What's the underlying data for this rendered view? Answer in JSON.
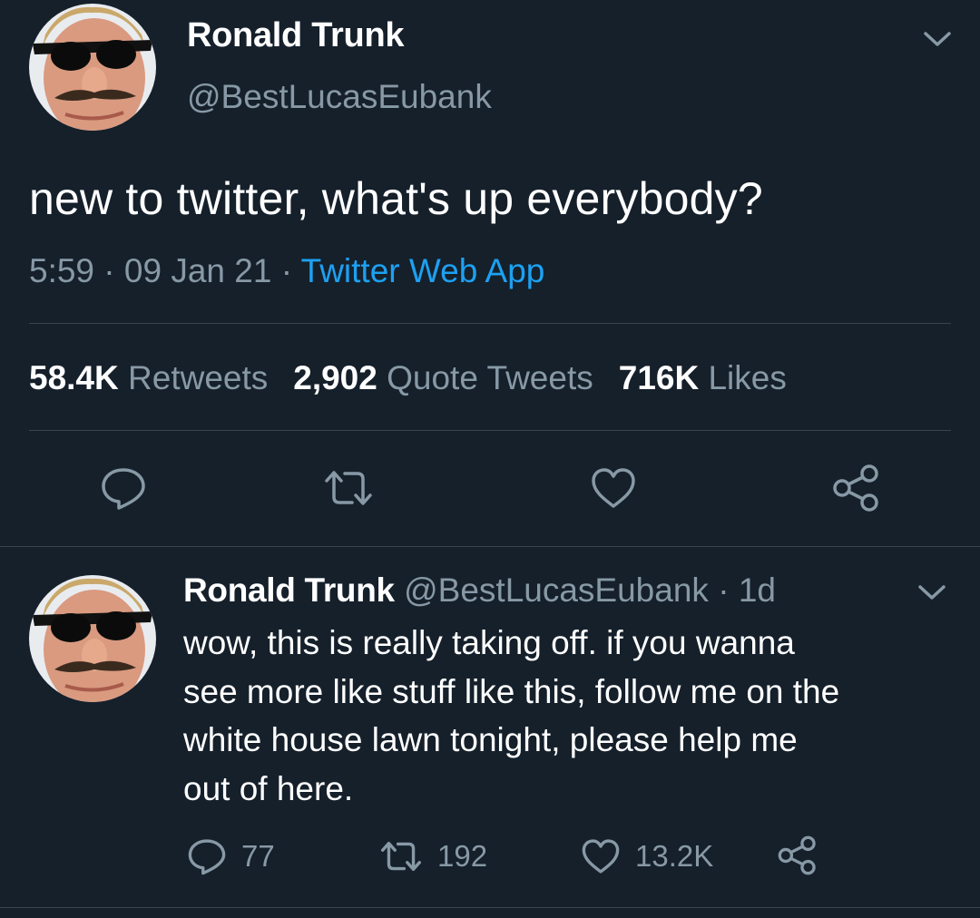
{
  "main_tweet": {
    "display_name": "Ronald Trunk",
    "handle": "@BestLucasEubank",
    "text": "new to twitter, what's up everybody?",
    "time": "5:59",
    "separator": " · ",
    "date": "09 Jan 21",
    "source": "Twitter Web App",
    "stats": {
      "retweets_count": "58.4K",
      "retweets_label": "Retweets",
      "quotes_count": "2,902",
      "quotes_label": "Quote Tweets",
      "likes_count": "716K",
      "likes_label": "Likes"
    },
    "icons": {
      "menu": "chevron-down-icon",
      "reply": "reply-bubble-icon",
      "retweet": "retweet-icon",
      "like": "heart-icon",
      "share": "share-icon"
    }
  },
  "reply_tweet": {
    "display_name": "Ronald Trunk",
    "handle": "@BestLucasEubank",
    "age": "1d",
    "separator": " · ",
    "lines": [
      "wow, this is really taking off. if you wanna",
      "see more like stuff like this, follow me on the",
      "white house lawn tonight, please help me",
      "out of here."
    ],
    "reply_count": "77",
    "retweet_count": "192",
    "like_count": "13.2K"
  },
  "colors": {
    "background": "#15202b",
    "secondary_text": "#8899a6",
    "link": "#1da1f2",
    "divider": "#38444d"
  }
}
